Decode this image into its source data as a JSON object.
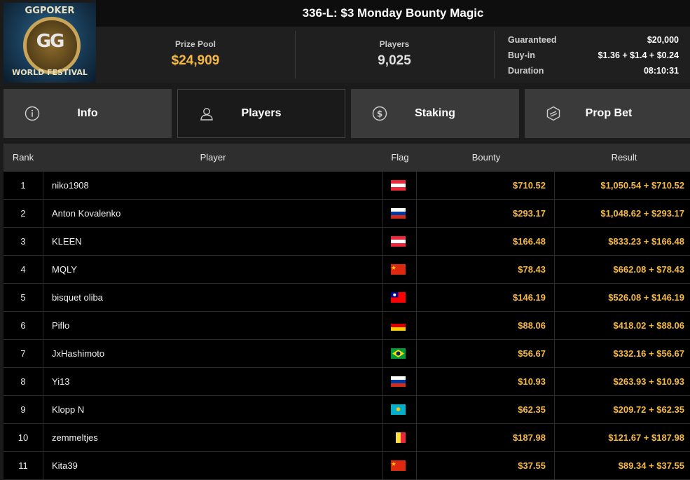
{
  "header": {
    "logo_top": "GGPOKER",
    "logo_center": "GG",
    "logo_bottom": "WORLD FESTIVAL",
    "title": "336-L: $3 Monday Bounty Magic",
    "prize_pool_label": "Prize Pool",
    "prize_pool_value": "$24,909",
    "players_label": "Players",
    "players_value": "9,025",
    "details": [
      {
        "key": "Guaranteed",
        "value": "$20,000"
      },
      {
        "key": "Buy-in",
        "value": "$1.36 + $1.4 + $0.24"
      },
      {
        "key": "Duration",
        "value": "08:10:31"
      }
    ]
  },
  "tabs": [
    {
      "label": "Info",
      "icon": "info-icon",
      "active": false
    },
    {
      "label": "Players",
      "icon": "person-icon",
      "active": true
    },
    {
      "label": "Staking",
      "icon": "dollar-coin-icon",
      "active": false
    },
    {
      "label": "Prop Bet",
      "icon": "prop-bet-icon",
      "active": false
    }
  ],
  "table": {
    "columns": [
      "Rank",
      "Player",
      "Flag",
      "Bounty",
      "Result"
    ],
    "rows": [
      {
        "rank": "1",
        "player": "niko1908",
        "flag": "austria",
        "bounty": "$710.52",
        "result": "$1,050.54 + $710.52"
      },
      {
        "rank": "2",
        "player": "Anton Kovalenko",
        "flag": "russia",
        "bounty": "$293.17",
        "result": "$1,048.62 + $293.17"
      },
      {
        "rank": "3",
        "player": "KLEEN",
        "flag": "austria",
        "bounty": "$166.48",
        "result": "$833.23 + $166.48"
      },
      {
        "rank": "4",
        "player": "MQLY",
        "flag": "china",
        "bounty": "$78.43",
        "result": "$662.08 + $78.43"
      },
      {
        "rank": "5",
        "player": "bisquet oliba",
        "flag": "taiwan",
        "bounty": "$146.19",
        "result": "$526.08 + $146.19"
      },
      {
        "rank": "6",
        "player": "Piflo",
        "flag": "germany",
        "bounty": "$88.06",
        "result": "$418.02 + $88.06"
      },
      {
        "rank": "7",
        "player": "JxHashimoto",
        "flag": "brazil",
        "bounty": "$56.67",
        "result": "$332.16 + $56.67"
      },
      {
        "rank": "8",
        "player": "Yi13",
        "flag": "russia",
        "bounty": "$10.93",
        "result": "$263.93 + $10.93"
      },
      {
        "rank": "9",
        "player": "Klopp N",
        "flag": "kazakhstan",
        "bounty": "$62.35",
        "result": "$209.72 + $62.35"
      },
      {
        "rank": "10",
        "player": "zemmeltjes",
        "flag": "belgium",
        "bounty": "$187.98",
        "result": "$121.67 + $187.98"
      },
      {
        "rank": "11",
        "player": "Kita39",
        "flag": "china",
        "bounty": "$37.55",
        "result": "$89.34 + $37.55"
      }
    ]
  },
  "colors": {
    "accent": "#f5b944",
    "tab_bg": "#3a3a3a",
    "active_tab_bg": "#1a1a1a"
  }
}
